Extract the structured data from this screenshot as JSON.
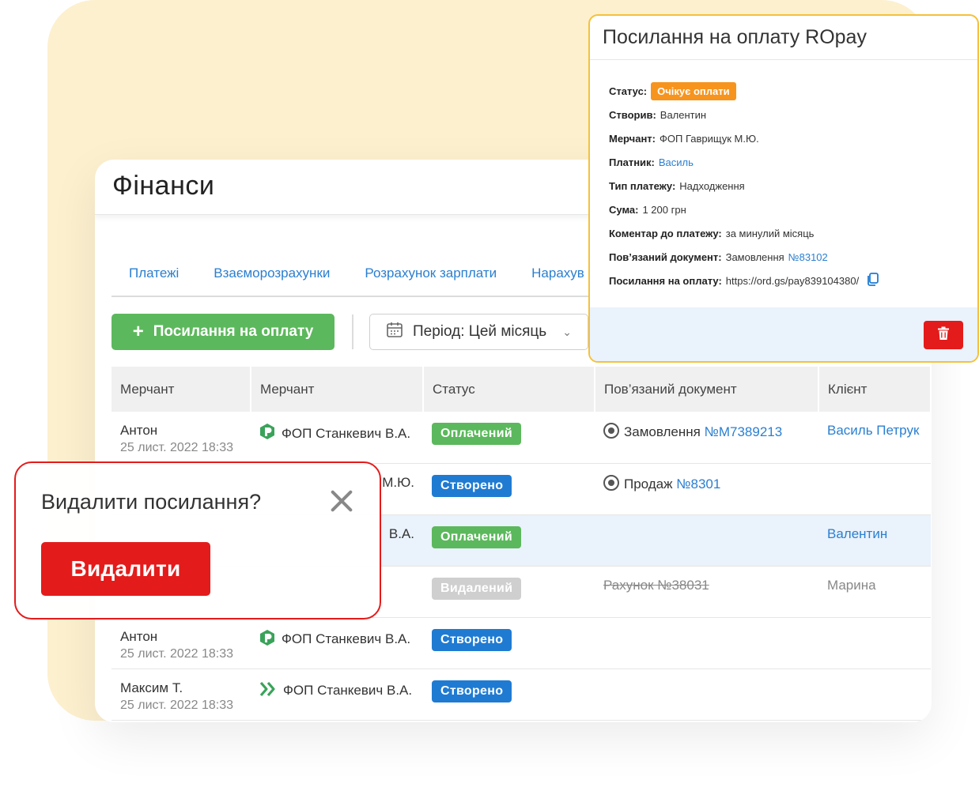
{
  "colors": {
    "background_blob": "#fdf0cf",
    "link": "#2a7fd0",
    "green": "#5cb85c",
    "blue_badge": "#1f7bd2",
    "grey_badge": "#cfcfcf",
    "orange_badge": "#f7941d",
    "red": "#e41b1b",
    "popup_border": "#f5c13a"
  },
  "finance": {
    "title": "Фінанси",
    "tabs": [
      {
        "label": "Платежі"
      },
      {
        "label": "Взаєморозрахунки"
      },
      {
        "label": "Розрахунок зарплати"
      },
      {
        "label": "Нарахув"
      }
    ],
    "add_button": {
      "icon": "plus-icon",
      "label": "Посилання на оплату"
    },
    "period": {
      "icon": "calendar-icon",
      "label": "Період: Цей місяць"
    },
    "table": {
      "columns": [
        "Мерчант",
        "Мерчант",
        "Статус",
        "Пов’язаний документ",
        "Клієнт"
      ],
      "rows": [
        {
          "name": "Антон",
          "date": "25 лист. 2022 18:33",
          "merchant_icon": "ropay-logo-icon",
          "merchant": "ФОП Станкевич В.А.",
          "status": "Оплачений",
          "status_color": "#5cb85c",
          "doc_label": "Замовлення",
          "doc_number": "№M7389213",
          "client": "Василь Петрук",
          "client_struck": false
        },
        {
          "name": "",
          "date": "",
          "merchant_icon": "",
          "merchant": "М.Ю.",
          "status": "Створено",
          "status_color": "#1f7bd2",
          "doc_label": "Продаж",
          "doc_number": "№8301",
          "client": ""
        },
        {
          "name": "",
          "date": "",
          "merchant_icon": "",
          "merchant": "В.А.",
          "status": "Оплачений",
          "status_color": "#5cb85c",
          "doc_label": "",
          "doc_number": "",
          "client": "Валентин"
        },
        {
          "name": "",
          "date": "",
          "merchant_icon": "",
          "merchant": "",
          "status": "Видалений",
          "status_color": "#cfcfcf",
          "doc_label": "Рахунок №38031",
          "doc_number": "",
          "client": "Марина"
        },
        {
          "name": "Антон",
          "date": "25 лист. 2022 18:33",
          "merchant_icon": "ropay-logo-icon",
          "merchant": "ФОП Станкевич В.А.",
          "status": "Створено",
          "status_color": "#1f7bd2",
          "doc_label": "",
          "doc_number": "",
          "client": ""
        },
        {
          "name": "Максим Т.",
          "date": "25 лист. 2022 18:33",
          "merchant_icon": "chevrons-logo-icon",
          "merchant": "ФОП Станкевич В.А.",
          "status": "Створено",
          "status_color": "#1f7bd2",
          "doc_label": "",
          "doc_number": "",
          "client": ""
        }
      ]
    }
  },
  "ropay_popup": {
    "title": "Посилання на оплату ROpay",
    "status_label": "Статус:",
    "status_value": "Очікує оплати",
    "created_label": "Створив:",
    "created_value": "Валентин",
    "merchant_label": "Мерчант:",
    "merchant_value": "ФОП Гаврищук М.Ю.",
    "payer_label": "Платник:",
    "payer_value": "Василь",
    "type_label": "Тип платежу:",
    "type_value": "Надходження",
    "sum_label": "Сума:",
    "sum_value": "1 200 грн",
    "comment_label": "Коментар до платежу:",
    "comment_value": "за минулий місяць",
    "doc_label": "Пов’язаний документ:",
    "doc_value": "Замовлення",
    "doc_number": "№83102",
    "link_label": "Посилання на оплату:",
    "link_value": "https://ord.gs/pay839104380/",
    "copy_icon": "copy-icon",
    "delete_icon": "trash-icon"
  },
  "confirm_popup": {
    "title": "Видалити посилання?",
    "close_icon": "close-icon",
    "delete_label": "Видалити"
  }
}
